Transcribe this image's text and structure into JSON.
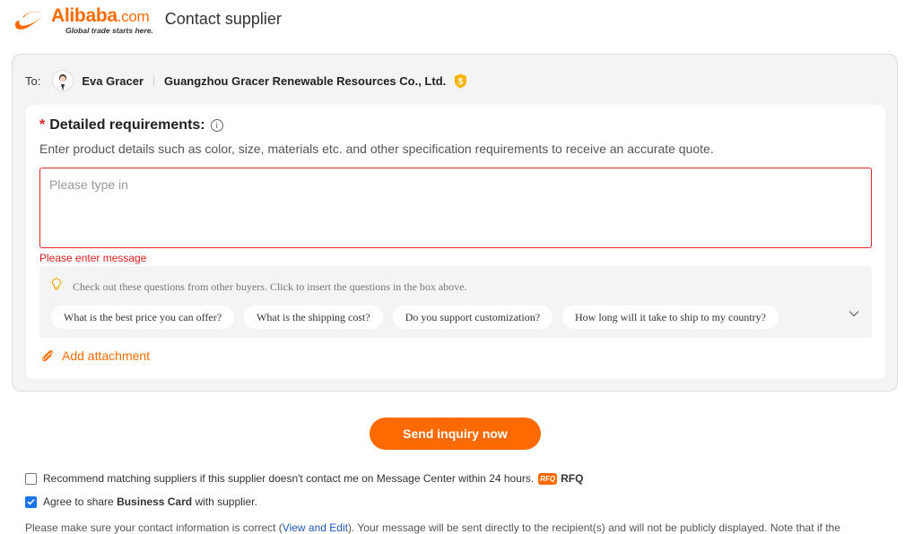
{
  "header": {
    "logo_word": "Alibaba",
    "logo_com": ".com",
    "logo_tagline": "Global trade starts here.",
    "title": "Contact supplier"
  },
  "recipient": {
    "to_label": "To:",
    "name": "Eva Gracer",
    "company": "Guangzhou Gracer Renewable Resources Co., Ltd."
  },
  "requirements": {
    "required_mark": "*",
    "title": "Detailed requirements:",
    "info_glyph": "i",
    "description": "Enter product details such as color, size, materials etc. and other specification requirements to receive an accurate quote.",
    "placeholder": "Please type in",
    "error": "Please enter message"
  },
  "suggestions": {
    "hint": "Check out these questions from other buyers. Click to insert the questions in the box above.",
    "questions": [
      "What is the best price you can offer?",
      "What is the shipping cost?",
      "Do you support customization?",
      "How long will it take to ship to my country?"
    ]
  },
  "attachment": {
    "label": "Add attachment"
  },
  "send_button": "Send inquiry now",
  "options": {
    "recommend": {
      "checked": false,
      "label": "Recommend matching suppliers if this supplier doesn't contact me on Message Center within 24 hours.",
      "badge": "RFQ",
      "tag": "RFQ"
    },
    "business_card": {
      "checked": true,
      "prefix": "Agree to share",
      "bold": "Business Card",
      "suffix": "with supplier."
    }
  },
  "footer": {
    "before": "Please make sure your contact information is correct (",
    "link": "View and Edit",
    "after": "). Your message will be sent directly to the recipient(s) and will not be publicly displayed. Note that if the"
  },
  "colors": {
    "brand": "#ff6a00",
    "error": "#e02020",
    "checkbox": "#1a73e8",
    "link": "#1a5ab8"
  }
}
